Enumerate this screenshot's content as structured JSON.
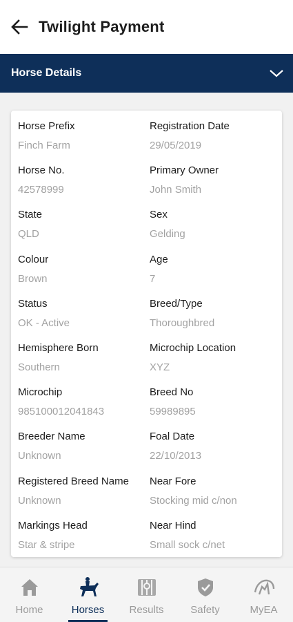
{
  "header": {
    "title": "Twilight Payment",
    "back_icon": "arrow-left-icon"
  },
  "section": {
    "title": "Horse Details",
    "expand_icon": "chevron-down-icon",
    "color": "#0e2f59"
  },
  "details": [
    {
      "label": "Horse Prefix",
      "value": "Finch Farm"
    },
    {
      "label": "Registration Date",
      "value": "29/05/2019"
    },
    {
      "label": "Horse No.",
      "value": "42578999"
    },
    {
      "label": "Primary Owner",
      "value": "John Smith"
    },
    {
      "label": "State",
      "value": "QLD"
    },
    {
      "label": "Sex",
      "value": "Gelding"
    },
    {
      "label": "Colour",
      "value": "Brown"
    },
    {
      "label": "Age",
      "value": "7"
    },
    {
      "label": "Status",
      "value": "OK - Active"
    },
    {
      "label": "Breed/Type",
      "value": "Thoroughbred"
    },
    {
      "label": "Hemisphere Born",
      "value": "Southern"
    },
    {
      "label": "Microchip Location",
      "value": "XYZ"
    },
    {
      "label": "Microchip",
      "value": "985100012041843"
    },
    {
      "label": "Breed No",
      "value": "59989895"
    },
    {
      "label": "Breeder Name",
      "value": "Unknown"
    },
    {
      "label": "Foal Date",
      "value": "22/10/2013"
    },
    {
      "label": "Registered Breed Name",
      "value": "Unknown"
    },
    {
      "label": "Near Fore",
      "value": "Stocking mid c/non"
    },
    {
      "label": "Markings Head",
      "value": "Star & stripe"
    },
    {
      "label": "Near Hind",
      "value": "Small sock c/net"
    }
  ],
  "nav": {
    "items": [
      {
        "label": "Home",
        "icon": "home-icon",
        "active": false
      },
      {
        "label": "Horses",
        "icon": "horse-rider-icon",
        "active": true
      },
      {
        "label": "Results",
        "icon": "results-icon",
        "active": false
      },
      {
        "label": "Safety",
        "icon": "shield-check-icon",
        "active": false
      },
      {
        "label": "MyEA",
        "icon": "myea-icon",
        "active": false
      }
    ],
    "active_color": "#0e2f59",
    "inactive_color": "#9a9a9a"
  }
}
